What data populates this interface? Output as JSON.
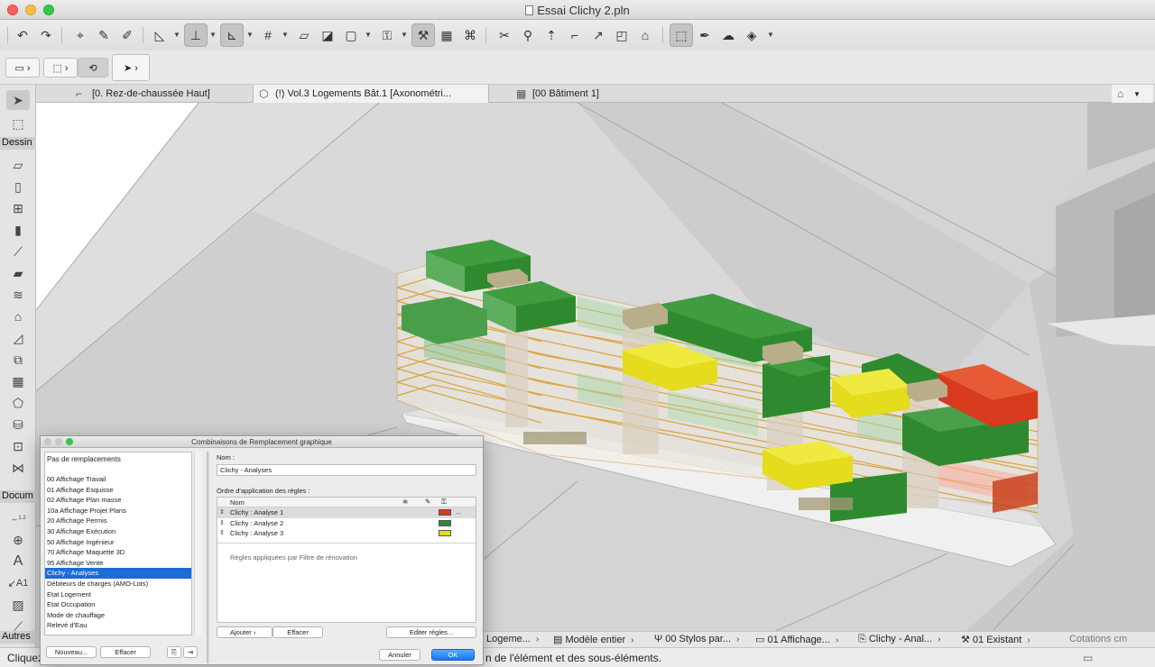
{
  "window": {
    "title": "Essai Clichy 2.pln"
  },
  "toolbar": {
    "icons": [
      "undo-icon",
      "redo-icon",
      "find-select-icon",
      "eyedropper-icon",
      "inject-icon",
      "guideline-icon",
      "snap-guides-icon",
      "snap-points-icon",
      "grid-snap-icon",
      "trace-icon",
      "layers-icon",
      "view-3d-icon",
      "lock-icon",
      "renovation-icon",
      "measure-icon",
      "offset-icon",
      "split-icon",
      "adjust-icon",
      "elevate-icon",
      "fillet-icon",
      "stretch-icon",
      "roof-icon",
      "suspend-groups-icon",
      "pen-icon",
      "edit-icon",
      "bucket-icon"
    ]
  },
  "tabs": [
    {
      "label": "[0. Rez-de-chaussée Haut]",
      "icon": "floorplan-icon"
    },
    {
      "label": "(!) Vol.3  Logements Bât.1  [Axonométri...",
      "icon": "cube-icon"
    },
    {
      "label": "[00 Bâtiment 1]",
      "icon": "grid-icon"
    }
  ],
  "toolbox": {
    "label_dessin": "Dessin",
    "label_docum": "Docum",
    "label_autres": "Autres",
    "dim_label_1": "1.2",
    "dim_label_2": "1.2",
    "text_tool": "A",
    "label_tool": "A1"
  },
  "statusbar": {
    "items": [
      {
        "label": "Logeme..."
      },
      {
        "label": "Modèle entier"
      },
      {
        "label": "00 Stylos par..."
      },
      {
        "label": "01 Affichage..."
      },
      {
        "label": "Clichy - Anal..."
      },
      {
        "label": "01 Existant"
      },
      {
        "label": "Cotations cm"
      }
    ],
    "hint_left": "Cliquez",
    "hint_right": "n de l'élément et des sous-éléments."
  },
  "dialog": {
    "title": "Combinaisons de Remplacement graphique",
    "list_header": "Pas de remplacements",
    "list_items": [
      "00 Affichage Travail",
      "01 Affichage Esquisse",
      "02 Affichage Plan masse",
      "10a Affichage Projet Plans",
      "20 Affichage Permis",
      "30 Affichage Exécution",
      "50 Affichage Ingénieur",
      "70 Affichage Maquette 3D",
      "95 Affichage Vente",
      "Clichy - Analyses",
      "Débiteurs de charges (AMO-Lots)",
      "Etat Logement",
      "Etat Occupation",
      "Mode de chauffage",
      "Relevé d'Eau"
    ],
    "selected_index": 9,
    "btn_new": "Nouveau...",
    "btn_clear_left": "Effacer",
    "name_label": "Nom :",
    "name_value": "Clichy - Analyses",
    "order_label": "Ordre d'application des règles :",
    "col_name": "Nom",
    "rules": [
      {
        "name": "Clichy : Analyse 1",
        "color": "#d83a1e"
      },
      {
        "name": "Clichy : Analyse 2",
        "color": "#2f8a2f"
      },
      {
        "name": "Clichy : Analyse 3",
        "color": "#e4dc1c"
      }
    ],
    "more_btn": "...",
    "note": "Règles appliquées par Filtre de rénovation",
    "btn_add": "Ajouter",
    "btn_clear_right": "Effacer",
    "btn_edit": "Editer règles...",
    "btn_cancel": "Annuler",
    "btn_ok": "OK"
  }
}
